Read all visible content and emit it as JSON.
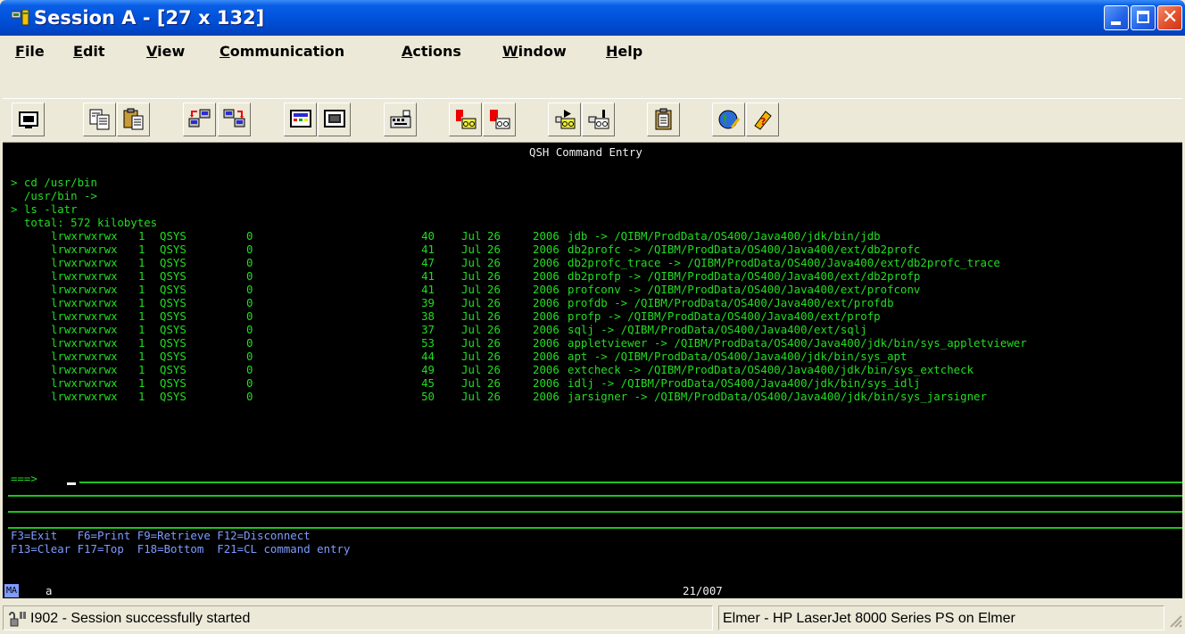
{
  "window": {
    "title": "Session A - [27 x 132]"
  },
  "menu": {
    "items": [
      {
        "first": "F",
        "rest": "ile"
      },
      {
        "first": "E",
        "rest": "dit"
      },
      {
        "first": "V",
        "rest": "iew"
      },
      {
        "first": "C",
        "rest": "ommunication"
      },
      {
        "first": "A",
        "rest": "ctions"
      },
      {
        "first": "W",
        "rest": "indow"
      },
      {
        "first": "H",
        "rest": "elp"
      }
    ]
  },
  "toolbar": {
    "icons": [
      "print-screen-icon",
      "copy-icon",
      "paste-icon",
      "send-file-icon",
      "receive-file-icon",
      "display-keypad-icon",
      "quick-keypad-icon",
      "macro-icon",
      "record-macro-icon",
      "stop-macro-icon",
      "play-macro-icon",
      "macro-playback-icon",
      "clipboard-icon",
      "web-icon",
      "help-icon"
    ]
  },
  "terminal": {
    "header": "QSH Command Entry",
    "commands": [
      "> cd /usr/bin",
      "  /usr/bin ->",
      "> ls -latr",
      "  total: 572 kilobytes"
    ],
    "listing": [
      {
        "perms": "lrwxrwxrwx",
        "links": "1",
        "owner": "QSYS",
        "group": "0",
        "size": "40",
        "month": "Jul",
        "day": "26",
        "year": "2006",
        "entry": "jdb -> /QIBM/ProdData/OS400/Java400/jdk/bin/jdb"
      },
      {
        "perms": "lrwxrwxrwx",
        "links": "1",
        "owner": "QSYS",
        "group": "0",
        "size": "41",
        "month": "Jul",
        "day": "26",
        "year": "2006",
        "entry": "db2profc -> /QIBM/ProdData/OS400/Java400/ext/db2profc"
      },
      {
        "perms": "lrwxrwxrwx",
        "links": "1",
        "owner": "QSYS",
        "group": "0",
        "size": "47",
        "month": "Jul",
        "day": "26",
        "year": "2006",
        "entry": "db2profc_trace -> /QIBM/ProdData/OS400/Java400/ext/db2profc_trace"
      },
      {
        "perms": "lrwxrwxrwx",
        "links": "1",
        "owner": "QSYS",
        "group": "0",
        "size": "41",
        "month": "Jul",
        "day": "26",
        "year": "2006",
        "entry": "db2profp -> /QIBM/ProdData/OS400/Java400/ext/db2profp"
      },
      {
        "perms": "lrwxrwxrwx",
        "links": "1",
        "owner": "QSYS",
        "group": "0",
        "size": "41",
        "month": "Jul",
        "day": "26",
        "year": "2006",
        "entry": "profconv -> /QIBM/ProdData/OS400/Java400/ext/profconv"
      },
      {
        "perms": "lrwxrwxrwx",
        "links": "1",
        "owner": "QSYS",
        "group": "0",
        "size": "39",
        "month": "Jul",
        "day": "26",
        "year": "2006",
        "entry": "profdb -> /QIBM/ProdData/OS400/Java400/ext/profdb"
      },
      {
        "perms": "lrwxrwxrwx",
        "links": "1",
        "owner": "QSYS",
        "group": "0",
        "size": "38",
        "month": "Jul",
        "day": "26",
        "year": "2006",
        "entry": "profp -> /QIBM/ProdData/OS400/Java400/ext/profp"
      },
      {
        "perms": "lrwxrwxrwx",
        "links": "1",
        "owner": "QSYS",
        "group": "0",
        "size": "37",
        "month": "Jul",
        "day": "26",
        "year": "2006",
        "entry": "sqlj -> /QIBM/ProdData/OS400/Java400/ext/sqlj"
      },
      {
        "perms": "lrwxrwxrwx",
        "links": "1",
        "owner": "QSYS",
        "group": "0",
        "size": "53",
        "month": "Jul",
        "day": "26",
        "year": "2006",
        "entry": "appletviewer -> /QIBM/ProdData/OS400/Java400/jdk/bin/sys_appletviewer"
      },
      {
        "perms": "lrwxrwxrwx",
        "links": "1",
        "owner": "QSYS",
        "group": "0",
        "size": "44",
        "month": "Jul",
        "day": "26",
        "year": "2006",
        "entry": "apt -> /QIBM/ProdData/OS400/Java400/jdk/bin/sys_apt"
      },
      {
        "perms": "lrwxrwxrwx",
        "links": "1",
        "owner": "QSYS",
        "group": "0",
        "size": "49",
        "month": "Jul",
        "day": "26",
        "year": "2006",
        "entry": "extcheck -> /QIBM/ProdData/OS400/Java400/jdk/bin/sys_extcheck"
      },
      {
        "perms": "lrwxrwxrwx",
        "links": "1",
        "owner": "QSYS",
        "group": "0",
        "size": "45",
        "month": "Jul",
        "day": "26",
        "year": "2006",
        "entry": "idlj -> /QIBM/ProdData/OS400/Java400/jdk/bin/sys_idlj"
      },
      {
        "perms": "lrwxrwxrwx",
        "links": "1",
        "owner": "QSYS",
        "group": "0",
        "size": "50",
        "month": "Jul",
        "day": "26",
        "year": "2006",
        "entry": "jarsigner -> /QIBM/ProdData/OS400/Java400/jdk/bin/sys_jarsigner"
      }
    ],
    "prompt": "===>",
    "input_value": "",
    "fkeys_line1": "F3=Exit   F6=Print F9=Retrieve F12=Disconnect",
    "fkeys_line2": "F13=Clear F17=Top  F18=Bottom  F21=CL command entry"
  },
  "oia": {
    "indicator": "MA",
    "session_letter": "a",
    "cursor_position": "21/007"
  },
  "statusbar": {
    "message": "I902 - Session successfully started",
    "printer": "Elmer - HP LaserJet 8000 Series PS on Elmer"
  },
  "colors": {
    "title_bar": "#0050d8",
    "terminal_bg": "#000000",
    "terminal_green": "#22dd22",
    "terminal_blue": "#7f9cff"
  }
}
